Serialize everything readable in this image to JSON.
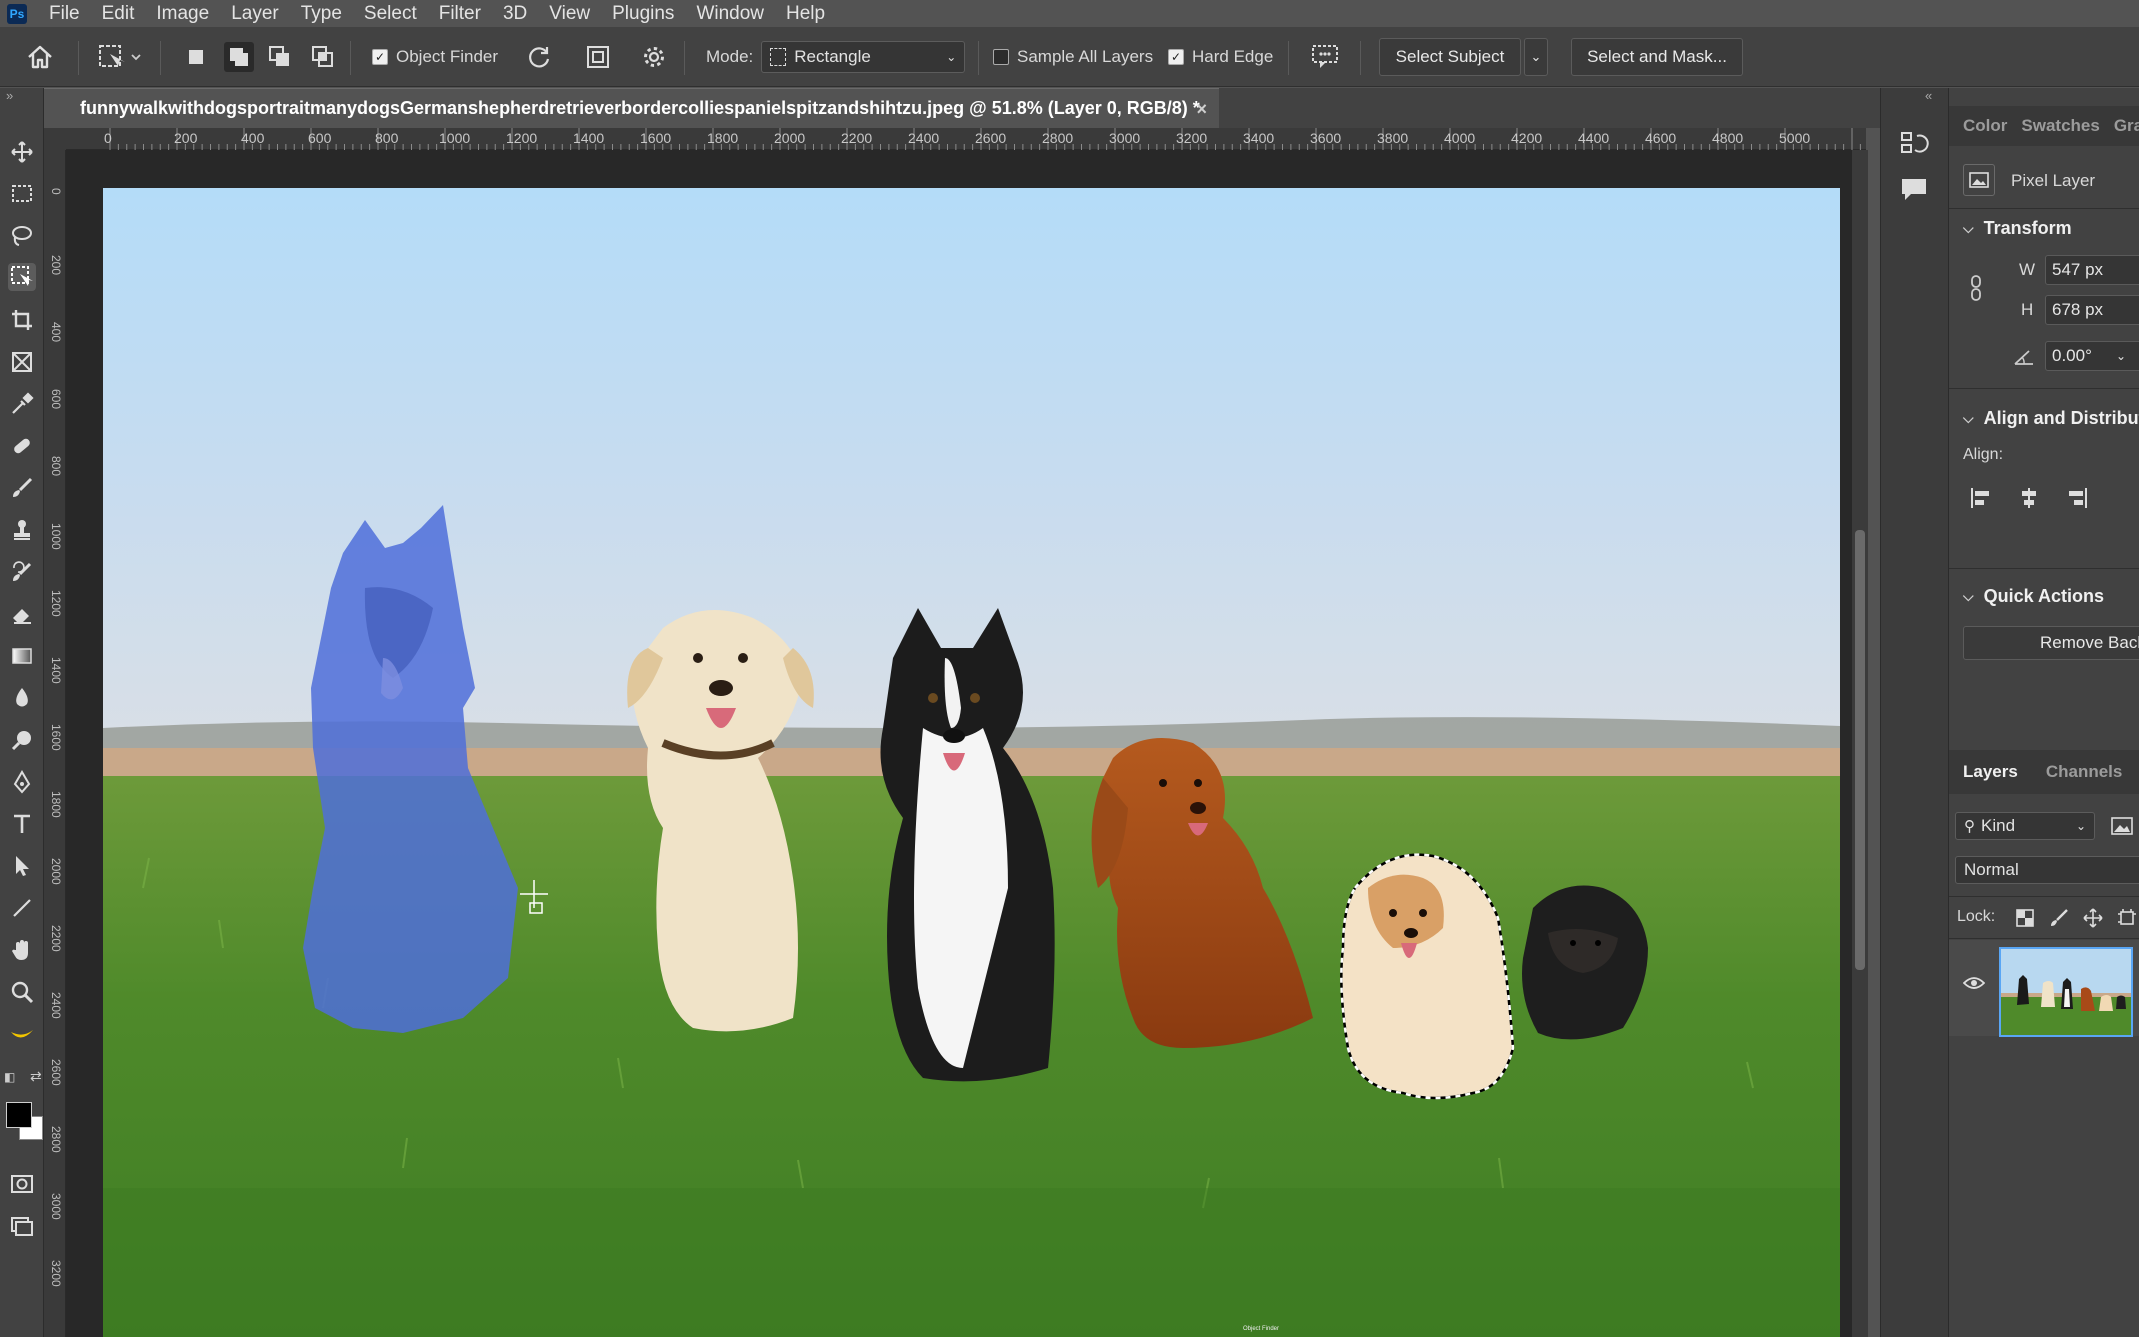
{
  "app": {
    "logo": "Ps"
  },
  "menu": [
    "File",
    "Edit",
    "Image",
    "Layer",
    "Type",
    "Select",
    "Filter",
    "3D",
    "View",
    "Plugins",
    "Window",
    "Help"
  ],
  "options": {
    "object_finder": {
      "label": "Object Finder",
      "checked": true
    },
    "mode_label": "Mode:",
    "mode_value": "Rectangle",
    "sample_all_layers": {
      "label": "Sample All Layers",
      "checked": false
    },
    "hard_edge": {
      "label": "Hard Edge",
      "checked": true
    },
    "select_subject": "Select Subject",
    "select_and_mask": "Select and Mask..."
  },
  "document": {
    "tab_title": "funnywalkwithdogsportraitmanydogsGermanshepherdretrieverbordercolliespanielspitzandshihtzu.jpeg @ 51.8% (Layer 0, RGB/8) *",
    "close_glyph": "×",
    "ruler_h": [
      "0",
      "200",
      "400",
      "600",
      "800",
      "1000",
      "1200",
      "1400",
      "1600",
      "1800",
      "2000",
      "2200",
      "2400",
      "2600",
      "2800",
      "3000",
      "3200",
      "3400",
      "3600",
      "3800",
      "4000",
      "4200",
      "4400",
      "4600",
      "4800",
      "5000"
    ],
    "ruler_v": [
      "0",
      "200",
      "400",
      "600",
      "800",
      "1000",
      "1200",
      "1400",
      "1600",
      "1800",
      "2000",
      "2200",
      "2400",
      "2600",
      "2800",
      "3000",
      "3200"
    ],
    "bottom_label": "Object Finder"
  },
  "properties": {
    "tabs": [
      "Color",
      "Swatches",
      "Gradients"
    ],
    "layer_type": "Pixel Layer",
    "transform": {
      "title": "Transform",
      "w_label": "W",
      "w": "547 px",
      "h_label": "H",
      "h": "678 px",
      "angle": "0.00°"
    },
    "align": {
      "title": "Align and Distribute",
      "label": "Align:"
    },
    "quick_actions": {
      "title": "Quick Actions",
      "remove_bg": "Remove Background"
    }
  },
  "layers": {
    "tabs": [
      "Layers",
      "Channels"
    ],
    "filter": "Kind",
    "blend_mode": "Normal",
    "lock_label": "Lock:"
  },
  "colors": {
    "foreground": "#000000",
    "background": "#ffffff",
    "selection_overlay": "#4f6fd9",
    "ui_bg": "#535353"
  }
}
